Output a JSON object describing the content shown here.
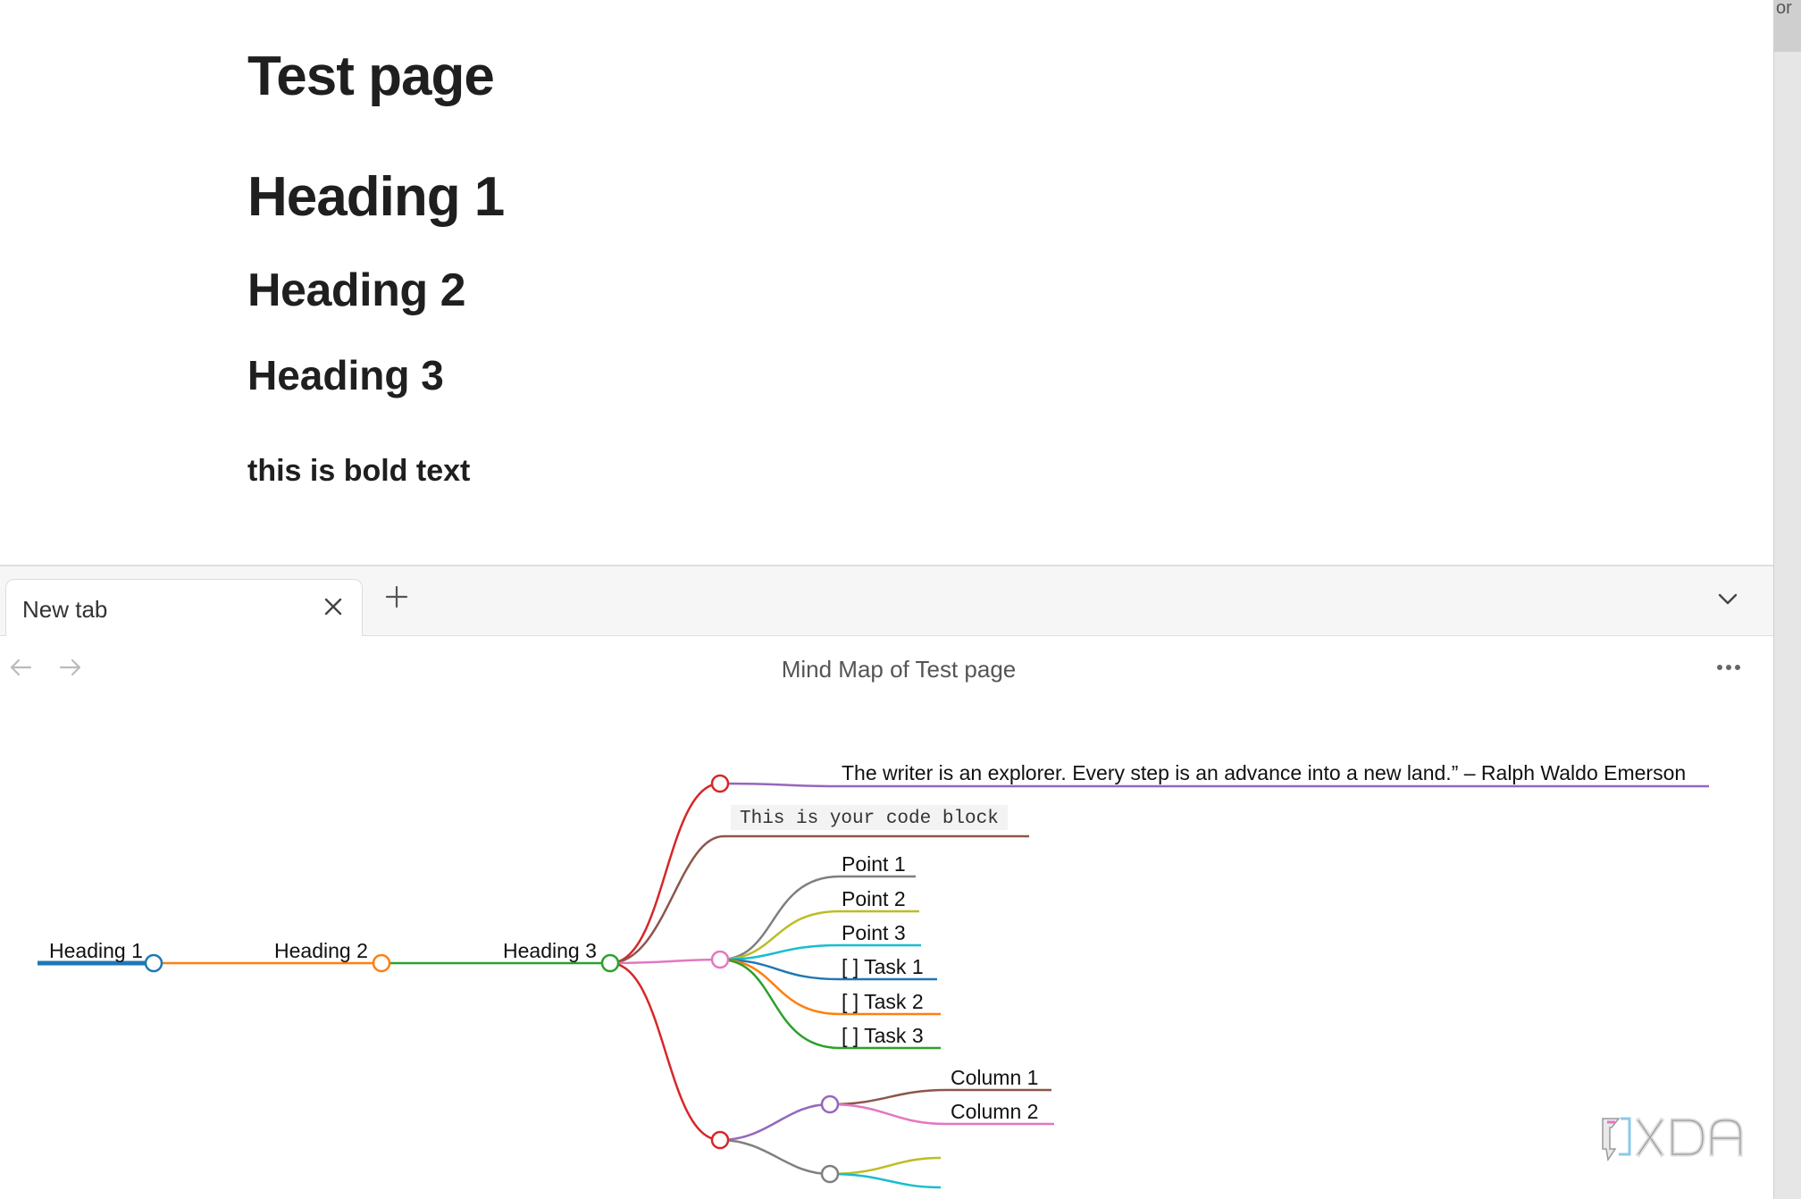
{
  "editor": {
    "title": "Test page",
    "heading1": "Heading 1",
    "heading2": "Heading 2",
    "heading3": "Heading 3",
    "bold_text": "this is bold text"
  },
  "scrollbar_peek": "or",
  "tabbar": {
    "tab_label": "New tab",
    "close_icon": "close-icon",
    "new_tab_icon": "plus-icon",
    "menu_icon": "chevron-down-icon"
  },
  "view": {
    "title": "Mind Map of Test page",
    "back_icon": "arrow-left-icon",
    "forward_icon": "arrow-right-icon",
    "more_icon": "more-horizontal-icon"
  },
  "mindmap": {
    "chain": [
      "Heading 1",
      "Heading 2",
      "Heading 3"
    ],
    "quote": "The writer is an explorer. Every step is an advance into a new land.” – Ralph Waldo Emerson",
    "code": "This is your code block",
    "list_items": [
      "Point 1",
      "Point 2",
      "Point 3",
      "[ ] Task 1",
      "[ ] Task 2",
      "[ ] Task 3"
    ],
    "columns": [
      "Column 1",
      "Column 2"
    ]
  },
  "watermark": "XDA",
  "colors": {
    "blue": "#1f77b4",
    "orange": "#ff7f0e",
    "green": "#2ca02c",
    "red": "#d62728",
    "purple": "#9467bd",
    "brown": "#8c564b",
    "pink": "#e377c2",
    "gray": "#7f7f7f",
    "olive": "#bcbd22",
    "cyan": "#17becf"
  }
}
